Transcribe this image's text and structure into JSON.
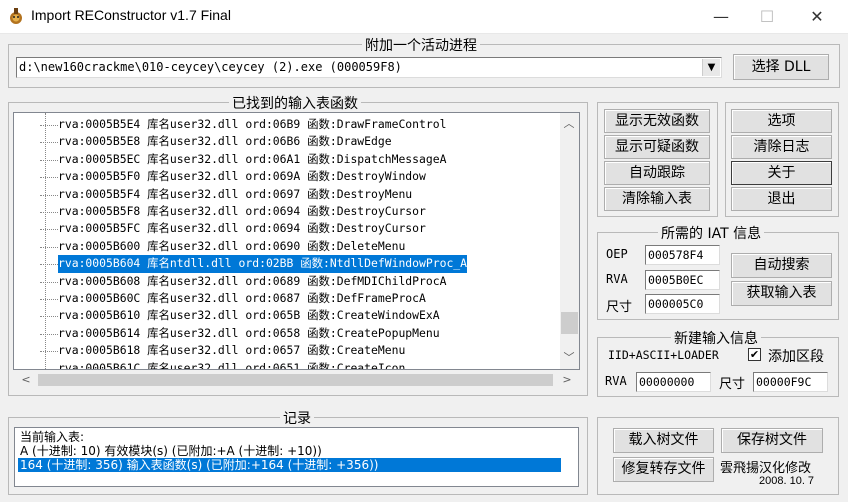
{
  "window": {
    "title": "Import REConstructor v1.7 Final",
    "minimize": "—",
    "maximize": "☐",
    "close": "✕"
  },
  "attach": {
    "legend": "附加一个活动进程",
    "process": "d:\\new160crackme\\010-ceycey\\ceycey (2).exe (000059F8)",
    "select_dll": "选择 DLL"
  },
  "imports": {
    "legend": "已找到的输入表函数",
    "rows": [
      {
        "text": "rva:0005B5E4 库名user32.dll ord:06B9 函数:DrawFrameControl",
        "selected": false
      },
      {
        "text": "rva:0005B5E8 库名user32.dll ord:06B6 函数:DrawEdge",
        "selected": false
      },
      {
        "text": "rva:0005B5EC 库名user32.dll ord:06A1 函数:DispatchMessageA",
        "selected": false
      },
      {
        "text": "rva:0005B5F0 库名user32.dll ord:069A 函数:DestroyWindow",
        "selected": false
      },
      {
        "text": "rva:0005B5F4 库名user32.dll ord:0697 函数:DestroyMenu",
        "selected": false
      },
      {
        "text": "rva:0005B5F8 库名user32.dll ord:0694 函数:DestroyCursor",
        "selected": false
      },
      {
        "text": "rva:0005B5FC 库名user32.dll ord:0694 函数:DestroyCursor",
        "selected": false
      },
      {
        "text": "rva:0005B600 库名user32.dll ord:0690 函数:DeleteMenu",
        "selected": false
      },
      {
        "text": "rva:0005B604 库名ntdll.dll ord:02BB 函数:NtdllDefWindowProc_A",
        "selected": true
      },
      {
        "text": "rva:0005B608 库名user32.dll ord:0689 函数:DefMDIChildProcA",
        "selected": false
      },
      {
        "text": "rva:0005B60C 库名user32.dll ord:0687 函数:DefFrameProcA",
        "selected": false
      },
      {
        "text": "rva:0005B610 库名user32.dll ord:065B 函数:CreateWindowExA",
        "selected": false
      },
      {
        "text": "rva:0005B614 库名user32.dll ord:0658 函数:CreatePopupMenu",
        "selected": false
      },
      {
        "text": "rva:0005B618 库名user32.dll ord:0657 函数:CreateMenu",
        "selected": false
      },
      {
        "text": "rva:0005B61C 库名user32.dll ord:0651 函数:CreateIcon",
        "selected": false
      }
    ]
  },
  "left_buttons": {
    "show_invalid": "显示无效函数",
    "show_suspect": "显示可疑函数",
    "auto_trace": "自动跟踪",
    "clear_imports": "清除输入表"
  },
  "right_buttons": {
    "options": "选项",
    "clear_log": "清除日志",
    "about": "关于",
    "exit": "退出"
  },
  "iat": {
    "legend": "所需的 IAT 信息",
    "oep_label": "OEP",
    "oep_value": "000578F4",
    "rva_label": "RVA",
    "rva_value": "0005B0EC",
    "size_label": "尺寸",
    "size_value": "000005C0",
    "auto_search": "自动搜索",
    "get_imports": "获取输入表"
  },
  "new_import": {
    "legend": "新建输入信息",
    "iid_label": "IID+ASCII+LOADER",
    "add_section_label": "添加区段",
    "add_section_checked": true,
    "rva_label": "RVA",
    "rva_value": "00000000",
    "size_label": "尺寸",
    "size_value": "00000F9C"
  },
  "log": {
    "legend": "记录",
    "lines": [
      {
        "text": "当前输入表:",
        "selected": false
      },
      {
        "text": "A (十进制: 10) 有效模块(s) (已附加:+A (十进制: +10))",
        "selected": false
      },
      {
        "text": "164 (十进制: 356) 输入表函数(s) (已附加:+164 (十进制: +356))",
        "selected": true
      }
    ]
  },
  "bottom_buttons": {
    "load_tree": "载入树文件",
    "save_tree": "保存树文件",
    "fix_dump": "修复转存文件"
  },
  "credits": {
    "translator": "雲飛揚汉化修改",
    "date": "2008. 10. 7"
  },
  "colors": {
    "selection": "#0078d7",
    "window_bg": "#f0f0f0"
  }
}
